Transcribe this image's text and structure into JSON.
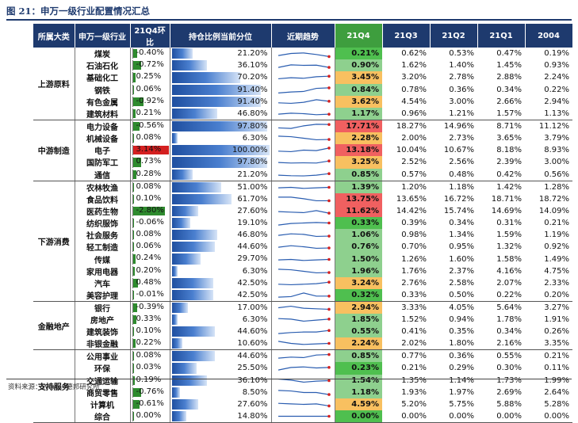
{
  "title": "图 21：申万一级行业配置情况汇总",
  "source": "资料来源：Wind，德邦研究所",
  "headers": {
    "sector": "所属大类",
    "industry": "申万一级行业",
    "chg": "21Q4环比",
    "pos": "持仓比例当前分位",
    "trend": "近期趋势",
    "q21q4": "21Q4",
    "q21q3": "21Q3",
    "q21q2": "21Q2",
    "q21q1": "21Q1",
    "q2004": "2004"
  },
  "colors": {
    "header_bg": "#1e3a6e",
    "q4_header_bg": "#3e9e3e",
    "pos_change": "#2e8b2e",
    "neg_change": "#2e8b2e",
    "top_change": "#d42020",
    "q4_high": "#f06060",
    "q4_mid": "#f8c060",
    "q4_low": "#8ed08e",
    "q4_lowest": "#4fbf4f"
  },
  "sectors": [
    {
      "name": "上游原料",
      "rows": [
        {
          "industry": "煤炭",
          "chg": "-0.40%",
          "chg_val": -0.4,
          "pos": "21.20%",
          "pos_val": 21.2,
          "q21q4": "0.21%",
          "q21q3": "0.62%",
          "q21q2": "0.53%",
          "q21q1": "0.47%",
          "q2004": "0.19%",
          "q4_color": "#4fbf4f",
          "trend": [
            0.3,
            0.5,
            0.55,
            0.4,
            0.2
          ]
        },
        {
          "industry": "石油石化",
          "chg": "-0.72%",
          "chg_val": -0.72,
          "pos": "36.10%",
          "pos_val": 36.1,
          "q21q4": "0.90%",
          "q21q3": "1.62%",
          "q21q2": "1.40%",
          "q21q1": "1.45%",
          "q2004": "0.93%",
          "q4_color": "#8ed08e",
          "trend": [
            0.3,
            0.55,
            0.5,
            0.52,
            0.3
          ]
        },
        {
          "industry": "基础化工",
          "chg": "0.25%",
          "chg_val": 0.25,
          "pos": "70.20%",
          "pos_val": 70.2,
          "q21q4": "3.45%",
          "q21q3": "3.20%",
          "q21q2": "2.78%",
          "q21q1": "2.88%",
          "q2004": "2.24%",
          "q4_color": "#f8c060",
          "trend": [
            0.35,
            0.45,
            0.4,
            0.55,
            0.6
          ]
        },
        {
          "industry": "钢铁",
          "chg": "0.06%",
          "chg_val": 0.06,
          "pos": "91.40%",
          "pos_val": 91.4,
          "q21q4": "0.84%",
          "q21q3": "0.78%",
          "q21q2": "0.36%",
          "q21q1": "0.34%",
          "q2004": "0.22%",
          "q4_color": "#8ed08e",
          "trend": [
            0.2,
            0.3,
            0.35,
            0.65,
            0.7
          ]
        },
        {
          "industry": "有色金属",
          "chg": "-0.92%",
          "chg_val": -0.92,
          "pos": "91.40%",
          "pos_val": 91.4,
          "q21q4": "3.62%",
          "q21q3": "4.54%",
          "q21q2": "3.00%",
          "q21q1": "2.66%",
          "q2004": "2.94%",
          "q4_color": "#f8c060",
          "trend": [
            0.4,
            0.35,
            0.45,
            0.7,
            0.55
          ]
        },
        {
          "industry": "建筑材料",
          "chg": "0.21%",
          "chg_val": 0.21,
          "pos": "46.80%",
          "pos_val": 46.8,
          "q21q4": "1.17%",
          "q21q3": "0.96%",
          "q21q2": "1.21%",
          "q21q1": "1.57%",
          "q2004": "1.13%",
          "q4_color": "#8ed08e",
          "trend": [
            0.45,
            0.55,
            0.5,
            0.4,
            0.45
          ]
        }
      ]
    },
    {
      "name": "中游制造",
      "rows": [
        {
          "industry": "电力设备",
          "chg": "-0.56%",
          "chg_val": -0.56,
          "pos": "97.80%",
          "pos_val": 97.8,
          "q21q4": "17.71%",
          "q21q3": "18.27%",
          "q21q2": "14.96%",
          "q21q1": "8.71%",
          "q2004": "11.12%",
          "q4_color": "#f06060",
          "trend": [
            0.35,
            0.3,
            0.55,
            0.7,
            0.68
          ]
        },
        {
          "industry": "机械设备",
          "chg": "0.08%",
          "chg_val": 0.08,
          "pos": "6.30%",
          "pos_val": 6.3,
          "q21q4": "2.28%",
          "q21q3": "2.00%",
          "q21q2": "2.73%",
          "q21q1": "3.65%",
          "q2004": "3.79%",
          "q4_color": "#f8c060",
          "trend": [
            0.7,
            0.65,
            0.5,
            0.35,
            0.38
          ]
        },
        {
          "industry": "电子",
          "chg": "3.14%",
          "chg_val": 3.14,
          "pos": "100.00%",
          "pos_val": 100.0,
          "q21q4": "13.18%",
          "q21q3": "10.04%",
          "q21q2": "10.67%",
          "q21q1": "8.18%",
          "q2004": "8.93%",
          "q4_color": "#f06060",
          "trend": [
            0.4,
            0.35,
            0.5,
            0.45,
            0.7
          ]
        },
        {
          "industry": "国防军工",
          "chg": "0.73%",
          "chg_val": 0.73,
          "pos": "97.80%",
          "pos_val": 97.8,
          "q21q4": "3.25%",
          "q21q3": "2.52%",
          "q21q2": "2.56%",
          "q21q1": "2.39%",
          "q2004": "3.00%",
          "q4_color": "#f8c060",
          "trend": [
            0.45,
            0.4,
            0.42,
            0.4,
            0.6
          ]
        },
        {
          "industry": "通信",
          "chg": "0.28%",
          "chg_val": 0.28,
          "pos": "21.20%",
          "pos_val": 21.2,
          "q21q4": "0.85%",
          "q21q3": "0.57%",
          "q21q2": "0.48%",
          "q21q1": "0.42%",
          "q2004": "0.56%",
          "q4_color": "#8ed08e",
          "trend": [
            0.45,
            0.4,
            0.38,
            0.45,
            0.6
          ]
        }
      ]
    },
    {
      "name": "下游消费",
      "rows": [
        {
          "industry": "农林牧渔",
          "chg": "0.08%",
          "chg_val": 0.08,
          "pos": "51.00%",
          "pos_val": 51.0,
          "q21q4": "1.39%",
          "q21q3": "1.20%",
          "q21q2": "1.18%",
          "q21q1": "1.42%",
          "q2004": "1.28%",
          "q4_color": "#8ed08e",
          "trend": [
            0.45,
            0.5,
            0.4,
            0.45,
            0.5
          ]
        },
        {
          "industry": "食品饮料",
          "chg": "0.10%",
          "chg_val": 0.1,
          "pos": "61.70%",
          "pos_val": 61.7,
          "q21q4": "13.75%",
          "q21q3": "13.65%",
          "q21q2": "16.72%",
          "q21q1": "18.71%",
          "q2004": "18.72%",
          "q4_color": "#f06060",
          "trend": [
            0.7,
            0.7,
            0.55,
            0.35,
            0.35
          ]
        },
        {
          "industry": "医药生物",
          "chg": "-2.80%",
          "chg_val": -2.8,
          "pos": "27.60%",
          "pos_val": 27.6,
          "q21q4": "11.62%",
          "q21q3": "14.42%",
          "q21q2": "15.74%",
          "q21q1": "14.69%",
          "q2004": "14.09%",
          "q4_color": "#f06060",
          "trend": [
            0.45,
            0.4,
            0.35,
            0.55,
            0.3
          ]
        },
        {
          "industry": "纺织服饰",
          "chg": "-0.06%",
          "chg_val": -0.06,
          "pos": "19.10%",
          "pos_val": 19.1,
          "q21q4": "0.33%",
          "q21q3": "0.39%",
          "q21q2": "0.34%",
          "q21q1": "0.31%",
          "q2004": "0.21%",
          "q4_color": "#4fbf4f",
          "trend": [
            0.3,
            0.45,
            0.5,
            0.55,
            0.5
          ]
        },
        {
          "industry": "社会服务",
          "chg": "0.08%",
          "chg_val": 0.08,
          "pos": "46.80%",
          "pos_val": 46.8,
          "q21q4": "1.06%",
          "q21q3": "0.98%",
          "q21q2": "1.34%",
          "q21q1": "1.59%",
          "q2004": "1.19%",
          "q4_color": "#8ed08e",
          "trend": [
            0.45,
            0.6,
            0.55,
            0.35,
            0.38
          ]
        },
        {
          "industry": "轻工制造",
          "chg": "0.06%",
          "chg_val": 0.06,
          "pos": "44.60%",
          "pos_val": 44.6,
          "q21q4": "0.76%",
          "q21q3": "0.70%",
          "q21q2": "0.95%",
          "q21q1": "1.32%",
          "q2004": "0.92%",
          "q4_color": "#8ed08e",
          "trend": [
            0.45,
            0.6,
            0.5,
            0.35,
            0.38
          ]
        },
        {
          "industry": "传媒",
          "chg": "0.24%",
          "chg_val": 0.24,
          "pos": "29.70%",
          "pos_val": 29.7,
          "q21q4": "1.50%",
          "q21q3": "1.26%",
          "q21q2": "1.60%",
          "q21q1": "1.58%",
          "q2004": "1.49%",
          "q4_color": "#8ed08e",
          "trend": [
            0.45,
            0.5,
            0.4,
            0.45,
            0.5
          ]
        },
        {
          "industry": "家用电器",
          "chg": "0.20%",
          "chg_val": 0.2,
          "pos": "6.30%",
          "pos_val": 6.3,
          "q21q4": "1.96%",
          "q21q3": "1.76%",
          "q21q2": "2.37%",
          "q21q1": "4.16%",
          "q2004": "4.75%",
          "q4_color": "#8ed08e",
          "trend": [
            0.7,
            0.65,
            0.5,
            0.35,
            0.38
          ]
        },
        {
          "industry": "汽车",
          "chg": "0.48%",
          "chg_val": 0.48,
          "pos": "42.50%",
          "pos_val": 42.5,
          "q21q4": "3.24%",
          "q21q3": "2.76%",
          "q21q2": "2.58%",
          "q21q1": "2.07%",
          "q2004": "2.33%",
          "q4_color": "#f8c060",
          "trend": [
            0.4,
            0.35,
            0.4,
            0.45,
            0.6
          ]
        },
        {
          "industry": "美容护理",
          "chg": "-0.01%",
          "chg_val": -0.01,
          "pos": "42.50%",
          "pos_val": 42.5,
          "q21q4": "0.32%",
          "q21q3": "0.33%",
          "q21q2": "0.50%",
          "q21q1": "0.22%",
          "q2004": "0.20%",
          "q4_color": "#4fbf4f",
          "trend": [
            0.3,
            0.35,
            0.7,
            0.4,
            0.4
          ]
        }
      ]
    },
    {
      "name": "金融地产",
      "rows": [
        {
          "industry": "银行",
          "chg": "-0.39%",
          "chg_val": -0.39,
          "pos": "17.00%",
          "pos_val": 17.0,
          "q21q4": "2.94%",
          "q21q3": "3.33%",
          "q21q2": "4.05%",
          "q21q1": "5.64%",
          "q2004": "3.27%",
          "q4_color": "#f8c060",
          "trend": [
            0.5,
            0.65,
            0.45,
            0.4,
            0.35
          ]
        },
        {
          "industry": "房地产",
          "chg": "0.33%",
          "chg_val": 0.33,
          "pos": "6.30%",
          "pos_val": 6.3,
          "q21q4": "1.85%",
          "q21q3": "1.52%",
          "q21q2": "0.94%",
          "q21q1": "1.78%",
          "q2004": "1.91%",
          "q4_color": "#8ed08e",
          "trend": [
            0.6,
            0.55,
            0.35,
            0.45,
            0.55
          ]
        },
        {
          "industry": "建筑装饰",
          "chg": "0.10%",
          "chg_val": 0.1,
          "pos": "44.60%",
          "pos_val": 44.6,
          "q21q4": "0.55%",
          "q21q3": "0.41%",
          "q21q2": "0.35%",
          "q21q1": "0.34%",
          "q2004": "0.26%",
          "q4_color": "#8ed08e",
          "trend": [
            0.3,
            0.4,
            0.45,
            0.45,
            0.6
          ]
        },
        {
          "industry": "非银金融",
          "chg": "0.22%",
          "chg_val": 0.22,
          "pos": "10.60%",
          "pos_val": 10.6,
          "q21q4": "2.24%",
          "q21q3": "2.02%",
          "q21q2": "1.80%",
          "q21q1": "2.16%",
          "q2004": "3.35%",
          "q4_color": "#f8c060",
          "trend": [
            0.7,
            0.5,
            0.4,
            0.45,
            0.5
          ]
        }
      ]
    },
    {
      "name": "支持服务",
      "rows": [
        {
          "industry": "公用事业",
          "chg": "0.08%",
          "chg_val": 0.08,
          "pos": "44.60%",
          "pos_val": 44.6,
          "q21q4": "0.85%",
          "q21q3": "0.77%",
          "q21q2": "0.36%",
          "q21q1": "0.55%",
          "q2004": "0.21%",
          "q4_color": "#8ed08e",
          "trend": [
            0.3,
            0.4,
            0.35,
            0.6,
            0.65
          ]
        },
        {
          "industry": "环保",
          "chg": "0.03%",
          "chg_val": 0.03,
          "pos": "25.50%",
          "pos_val": 25.5,
          "q21q4": "0.23%",
          "q21q3": "0.21%",
          "q21q2": "0.29%",
          "q21q1": "0.30%",
          "q2004": "0.11%",
          "q4_color": "#4fbf4f",
          "trend": [
            0.3,
            0.55,
            0.6,
            0.5,
            0.55
          ]
        },
        {
          "industry": "交通运输",
          "chg": "0.19%",
          "chg_val": 0.19,
          "pos": "36.10%",
          "pos_val": 36.1,
          "q21q4": "1.54%",
          "q21q3": "1.35%",
          "q21q2": "1.14%",
          "q21q1": "1.73%",
          "q2004": "1.99%",
          "q4_color": "#8ed08e",
          "trend": [
            0.65,
            0.55,
            0.35,
            0.45,
            0.5
          ]
        },
        {
          "industry": "商贸零售",
          "chg": "-0.76%",
          "chg_val": -0.76,
          "pos": "8.50%",
          "pos_val": 8.5,
          "q21q4": "1.18%",
          "q21q3": "1.93%",
          "q21q2": "1.97%",
          "q21q1": "2.69%",
          "q2004": "2.64%",
          "q4_color": "#8ed08e",
          "trend": [
            0.7,
            0.65,
            0.5,
            0.5,
            0.3
          ]
        },
        {
          "industry": "计算机",
          "chg": "-0.61%",
          "chg_val": -0.61,
          "pos": "27.60%",
          "pos_val": 27.6,
          "q21q4": "4.59%",
          "q21q3": "5.20%",
          "q21q2": "5.75%",
          "q21q1": "5.88%",
          "q2004": "5.28%",
          "q4_color": "#f8c060",
          "trend": [
            0.6,
            0.55,
            0.5,
            0.55,
            0.35
          ]
        },
        {
          "industry": "综合",
          "chg": "0.00%",
          "chg_val": 0.0,
          "pos": "14.80%",
          "pos_val": 14.8,
          "q21q4": "0.00%",
          "q21q3": "0.00%",
          "q21q2": "0.00%",
          "q21q1": "0.00%",
          "q2004": "0.00%",
          "q4_color": "#4fbf4f",
          "trend": [
            0.5,
            0.5,
            0.5,
            0.5,
            0.5
          ]
        }
      ]
    }
  ]
}
